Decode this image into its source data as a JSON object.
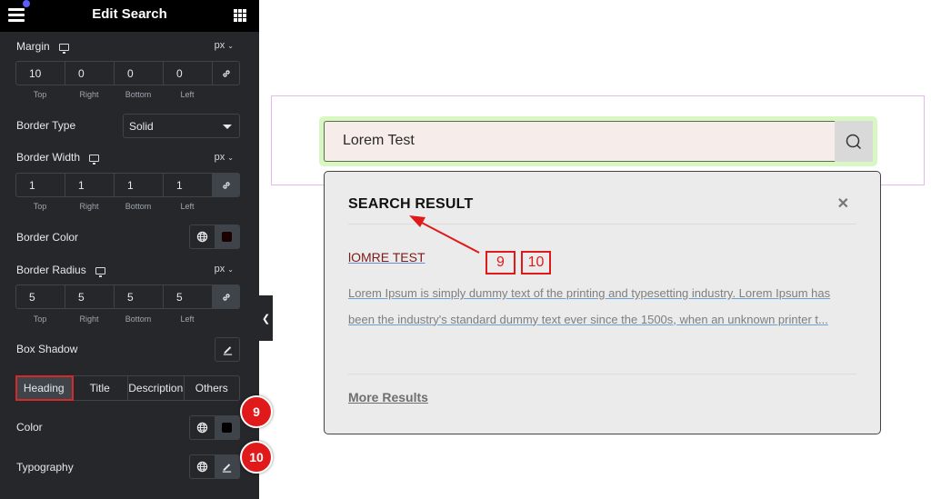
{
  "panel": {
    "title": "Edit Search",
    "margin": {
      "label": "Margin",
      "unit": "px",
      "values": [
        "10",
        "0",
        "0",
        "0"
      ],
      "side_labels": [
        "Top",
        "Right",
        "Bottom",
        "Left"
      ]
    },
    "border_type": {
      "label": "Border Type",
      "value": "Solid"
    },
    "border_width": {
      "label": "Border Width",
      "unit": "px",
      "values": [
        "1",
        "1",
        "1",
        "1"
      ],
      "side_labels": [
        "Top",
        "Right",
        "Bottom",
        "Left"
      ]
    },
    "border_color": {
      "label": "Border Color",
      "color": "#1a0000"
    },
    "border_radius": {
      "label": "Border Radius",
      "unit": "px",
      "values": [
        "5",
        "5",
        "5",
        "5"
      ],
      "side_labels": [
        "Top",
        "Right",
        "Bottom",
        "Left"
      ]
    },
    "box_shadow": {
      "label": "Box Shadow"
    },
    "tabs": [
      {
        "label": "Heading",
        "active": true
      },
      {
        "label": "Title",
        "active": false
      },
      {
        "label": "Description",
        "active": false
      },
      {
        "label": "Others",
        "active": false
      }
    ],
    "color": {
      "label": "Color",
      "color": "#000000"
    },
    "typography": {
      "label": "Typography"
    },
    "badges": [
      "9",
      "10"
    ]
  },
  "canvas": {
    "search_value": "Lorem Test",
    "results": {
      "heading": "SEARCH RESULT",
      "item_title": "lOMRE TEST",
      "item_description": "Lorem Ipsum is simply dummy text of the printing and typesetting industry. Lorem Ipsum has been the industry's standard dummy text ever since the 1500s, when an unknown printer t...",
      "more_link": "More Results"
    },
    "callouts": [
      "9",
      "10"
    ]
  }
}
